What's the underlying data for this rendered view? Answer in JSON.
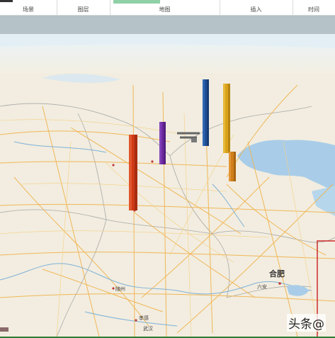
{
  "ribbon": {
    "groups": [
      "场景",
      "图层",
      "地图",
      "插入",
      "时间"
    ]
  },
  "map": {
    "cities": [
      "合肥",
      "武汉",
      "孝感",
      "随州",
      "六安"
    ],
    "columns": [
      {
        "name": "red-column",
        "color": "#cc3a16"
      },
      {
        "name": "purple-column",
        "color": "#6a2a9e"
      },
      {
        "name": "blue-column",
        "color": "#1f4e95"
      },
      {
        "name": "gold-column",
        "color": "#d9a11a"
      },
      {
        "name": "orange-column",
        "color": "#cf7e1b"
      }
    ]
  },
  "watermark": {
    "text": "头条@"
  }
}
